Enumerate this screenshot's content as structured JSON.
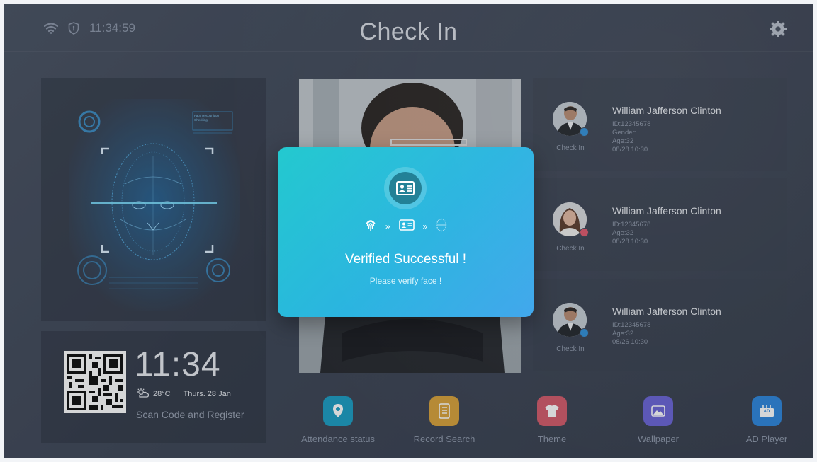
{
  "header": {
    "time": "11:34:59",
    "title": "Check In"
  },
  "face_panel": {
    "hud_label": "Face Recognition Checking"
  },
  "clock_panel": {
    "time": "11:34",
    "temperature": "28°C",
    "date": "Thurs. 28 Jan",
    "scan_label": "Scan Code and Register"
  },
  "records": [
    {
      "name": "William Jafferson Clinton",
      "id": "ID:12345678",
      "gender": "Gender:",
      "age": "Age:32",
      "datetime": "08/28  10:30",
      "status": "Check In",
      "badge_color": "#2f8fd8"
    },
    {
      "name": "William Jafferson Clinton",
      "id": "ID:12345678",
      "age": "Age:32",
      "datetime": "08/28  10:30",
      "status": "Check In",
      "badge_color": "#e0566b"
    },
    {
      "name": "William Jafferson Clinton",
      "id": "ID:12345678",
      "age": "Age:32",
      "datetime": "08/26  10:30",
      "status": "Check In",
      "badge_color": "#2f8fd8"
    }
  ],
  "dialog": {
    "message": "Verified Successful !",
    "sub_message": "Please verify face !",
    "step_separator": "»"
  },
  "dock": [
    {
      "label": "Attendance status",
      "icon": "location-pin-icon",
      "color": "#1d9ec4"
    },
    {
      "label": "Record Search",
      "icon": "notebook-icon",
      "color": "#d9a23a"
    },
    {
      "label": "Theme",
      "icon": "shirt-icon",
      "color": "#d45a6a"
    },
    {
      "label": "Wallpaper",
      "icon": "image-icon",
      "color": "#6a63d6"
    },
    {
      "label": "AD Player",
      "icon": "ad-player-icon",
      "color": "#2d86dc",
      "badge": "AD"
    }
  ]
}
